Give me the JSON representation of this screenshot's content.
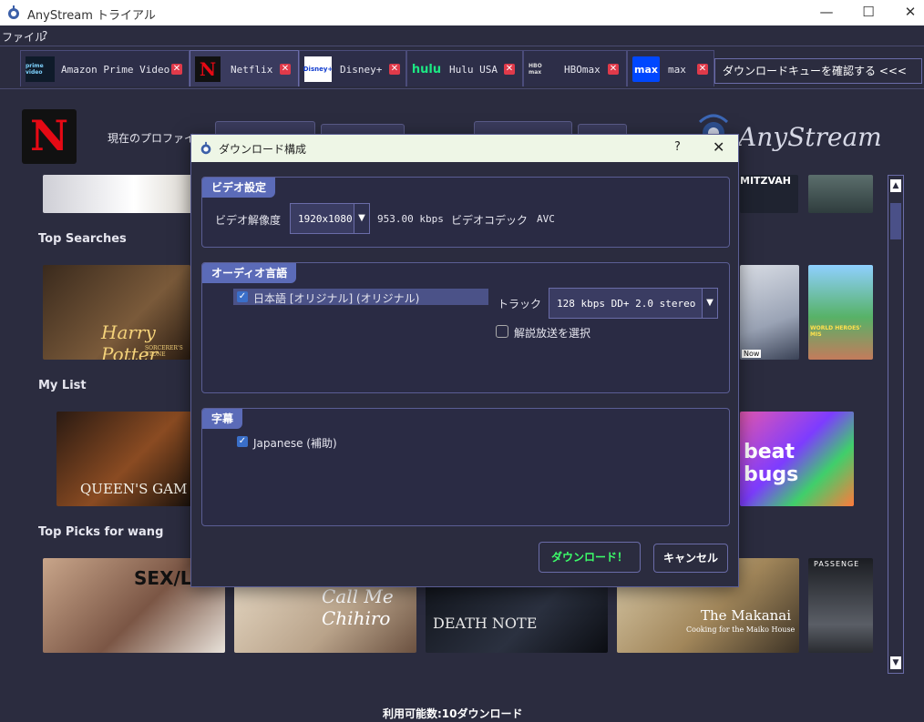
{
  "window": {
    "title": "AnyStream トライアル",
    "minimize": "—",
    "maximize": "☐",
    "close": "✕"
  },
  "menu": {
    "file": "ファイル",
    "help": "?"
  },
  "tabs": [
    {
      "label": "Amazon Prime Video",
      "logo": "prime video"
    },
    {
      "label": "Netflix",
      "logo": "N"
    },
    {
      "label": "Disney+",
      "logo": "Disney+"
    },
    {
      "label": "Hulu USA",
      "logo": "hulu"
    },
    {
      "label": "HBOmax",
      "logo": "HBO max"
    },
    {
      "label": "max",
      "logo": "max"
    }
  ],
  "tab_close": "✕",
  "queue_button": "ダウンロードキューを確認する <<<",
  "main": {
    "netflix_logo": "N",
    "profile_label": "現在のプロファイ",
    "brand": "AnyStream",
    "rows": [
      "Top Searches",
      "My List",
      "Top Picks for wang"
    ],
    "thumbs": {
      "mitzvah": "MITZVAH",
      "harry_potter": "Harry Potter",
      "sorcerers_stone": "SORCERER'S STONE",
      "now": "Now",
      "mha": "WORLD HEROES' MIS",
      "queens_gambit": "QUEEN'S GAM",
      "beat_bugs": "beat bugs",
      "sex_life": "SEX/LIFE",
      "chihiro": "Call Me Chihiro",
      "death_note": "DEATH NOTE",
      "makanai_title": "The Makanai",
      "makanai_sub": "Cooking for the Maiko House",
      "passenger": "PASSENGE"
    }
  },
  "status": "利用可能数:10ダウンロード",
  "dialog": {
    "title": "ダウンロード構成",
    "help": "?",
    "close": "✕",
    "video": {
      "group_title": "ビデオ設定",
      "resolution_label": "ビデオ解像度",
      "resolution_value": "1920x1080",
      "bitrate": "953.00 kbps",
      "codec_label": "ビデオコデック",
      "codec_value": "AVC"
    },
    "audio": {
      "group_title": "オーディオ言語",
      "language_item": "日本語 [オリジナル] (オリジナル)",
      "track_label": "トラック",
      "track_value": "128 kbps  DD+ 2.0  stereo",
      "description_label": "解説放送を選択"
    },
    "subtitle": {
      "group_title": "字幕",
      "item": "Japanese (補助)"
    },
    "download_button": "ダウンロード！",
    "cancel_button": "キャンセル"
  },
  "colors": {
    "background": "#2b2c3f",
    "group_header": "#5b6bb8",
    "download_text": "#3cff6a",
    "tab_close": "#e03a4a",
    "netflix_red": "#e50914"
  }
}
